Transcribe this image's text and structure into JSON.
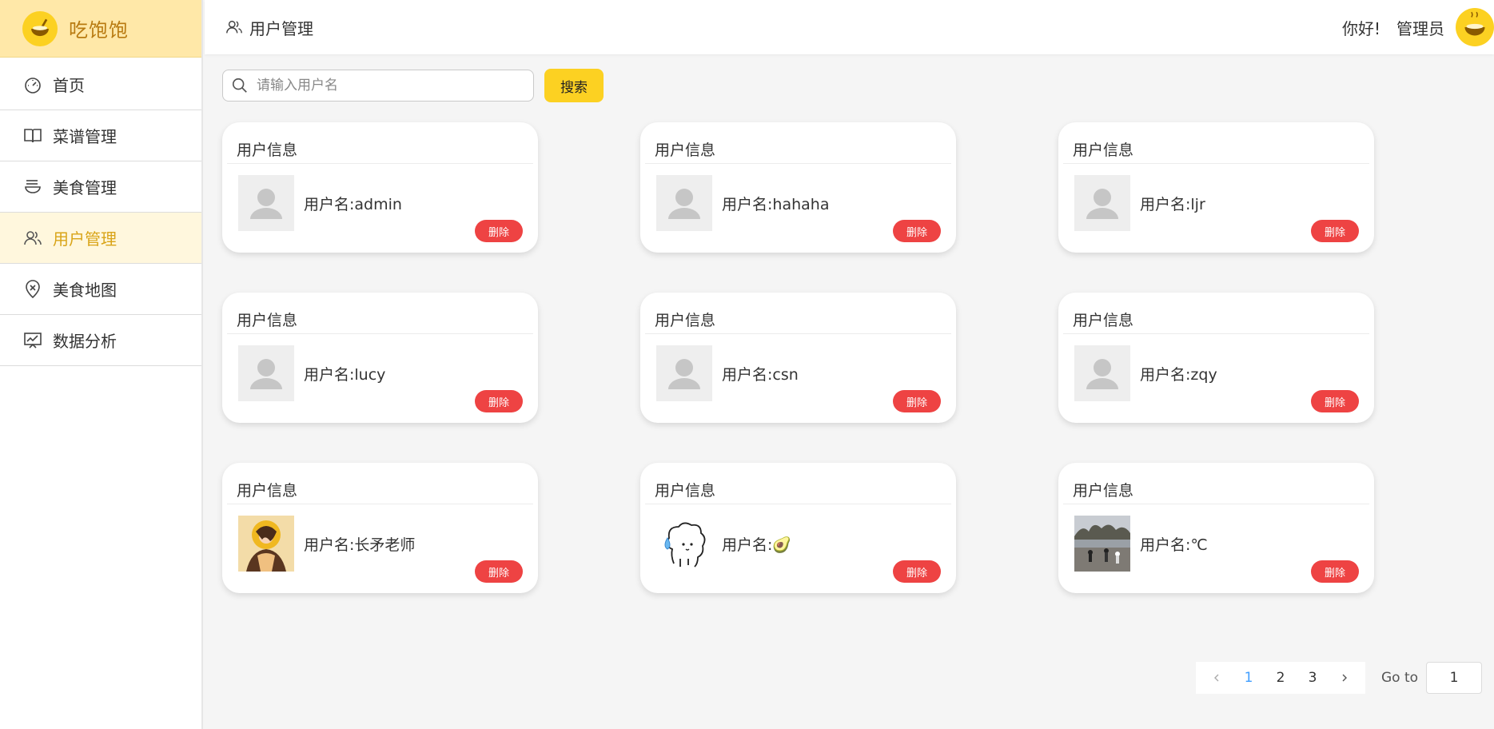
{
  "brand": {
    "name": "吃饱饱",
    "logo_icon": "rice-bowl-icon",
    "accent": "#fcd122"
  },
  "sidebar": {
    "items": [
      {
        "label": "首页",
        "icon": "dashboard-icon",
        "active": false
      },
      {
        "label": "菜谱管理",
        "icon": "book-icon",
        "active": false
      },
      {
        "label": "美食管理",
        "icon": "bowl-icon",
        "active": false
      },
      {
        "label": "用户管理",
        "icon": "users-icon",
        "active": true
      },
      {
        "label": "美食地图",
        "icon": "map-pin-icon",
        "active": false
      },
      {
        "label": "数据分析",
        "icon": "chart-icon",
        "active": false
      }
    ]
  },
  "header": {
    "title": "用户管理",
    "greeting": "你好!",
    "user_name": "管理员"
  },
  "search": {
    "placeholder": "请输入用户名",
    "value": "",
    "button_label": "搜索"
  },
  "cards": [
    {
      "title": "用户信息",
      "label": "用户名:",
      "username": "admin",
      "avatar": "default-avatar-icon",
      "delete_label": "删除"
    },
    {
      "title": "用户信息",
      "label": "用户名:",
      "username": "hahaha",
      "avatar": "default-avatar-icon",
      "delete_label": "删除"
    },
    {
      "title": "用户信息",
      "label": "用户名:",
      "username": "ljr",
      "avatar": "default-avatar-icon",
      "delete_label": "删除"
    },
    {
      "title": "用户信息",
      "label": "用户名:",
      "username": "lucy",
      "avatar": "default-avatar-icon",
      "delete_label": "删除"
    },
    {
      "title": "用户信息",
      "label": "用户名:",
      "username": "csn",
      "avatar": "default-avatar-icon",
      "delete_label": "删除"
    },
    {
      "title": "用户信息",
      "label": "用户名:",
      "username": "zqy",
      "avatar": "default-avatar-icon",
      "delete_label": "删除"
    },
    {
      "title": "用户信息",
      "label": "用户名:",
      "username": "长矛老师",
      "avatar": "illustrated-girl-avatar",
      "delete_label": "删除"
    },
    {
      "title": "用户信息",
      "label": "用户名:",
      "username": "🥑",
      "avatar": "cartoon-ghost-avatar",
      "delete_label": "删除"
    },
    {
      "title": "用户信息",
      "label": "用户名:",
      "username": "℃",
      "avatar": "photo-avatar",
      "delete_label": "删除"
    }
  ],
  "pagination": {
    "pages": [
      "1",
      "2",
      "3"
    ],
    "current": "1",
    "goto_label": "Go to",
    "goto_value": "1"
  },
  "colors": {
    "danger": "#ee4343",
    "active_menu_bg": "#fff7dd",
    "active_menu_text": "#d9a418",
    "page_active": "#409eff"
  }
}
